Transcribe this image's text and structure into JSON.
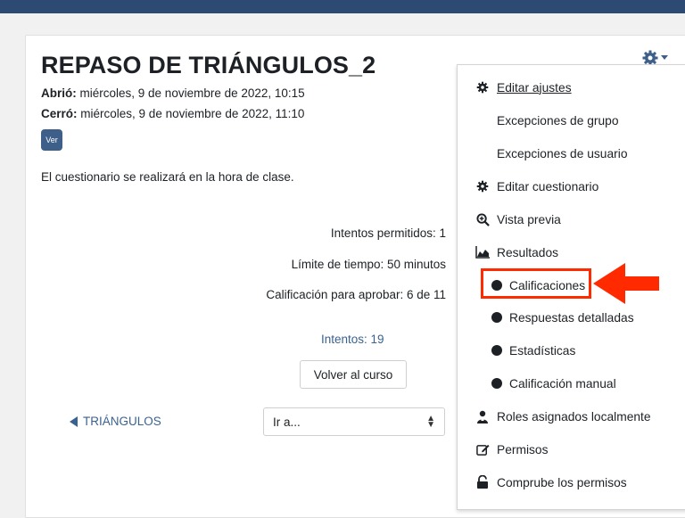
{
  "title": "REPASO DE TRIÁNGULOS_2",
  "opened": {
    "label": "Abrió:",
    "value": "miércoles, 9 de noviembre de 2022, 10:15"
  },
  "closed": {
    "label": "Cerró:",
    "value": "miércoles, 9 de noviembre de 2022, 11:10"
  },
  "ver_button": "Ver",
  "description": "El cuestionario se realizará en la hora de clase.",
  "info": {
    "attempts_allowed": "Intentos permitidos: 1",
    "time_limit": "Límite de tiempo: 50 minutos",
    "pass_grade": "Calificación para aprobar: 6 de 11"
  },
  "attempts_link": "Intentos: 19",
  "back_button": "Volver al curso",
  "nav": {
    "prev_label": "TRIÁNGULOS",
    "jump_placeholder": "Ir a..."
  },
  "menu": {
    "items": [
      {
        "label": "Editar ajustes",
        "icon": "gear-icon"
      },
      {
        "label": "Excepciones de grupo"
      },
      {
        "label": "Excepciones de usuario"
      },
      {
        "label": "Editar cuestionario",
        "icon": "gear-icon"
      },
      {
        "label": "Vista previa",
        "icon": "magnifier-icon"
      },
      {
        "label": "Resultados",
        "icon": "area-chart-icon"
      },
      {
        "label": "Calificaciones",
        "icon": "bullet-icon"
      },
      {
        "label": "Respuestas detalladas",
        "icon": "bullet-icon"
      },
      {
        "label": "Estadísticas",
        "icon": "bullet-icon"
      },
      {
        "label": "Calificación manual",
        "icon": "bullet-icon"
      },
      {
        "label": "Roles asignados localmente",
        "icon": "user-icon"
      },
      {
        "label": "Permisos",
        "icon": "pencil-square-icon"
      },
      {
        "label": "Comprube los permisos",
        "icon": "unlock-icon"
      }
    ]
  },
  "colors": {
    "topbar": "#2d4a72",
    "link": "#3a6290",
    "button": "#3e5f8a",
    "annotation": "#ff2a00"
  }
}
